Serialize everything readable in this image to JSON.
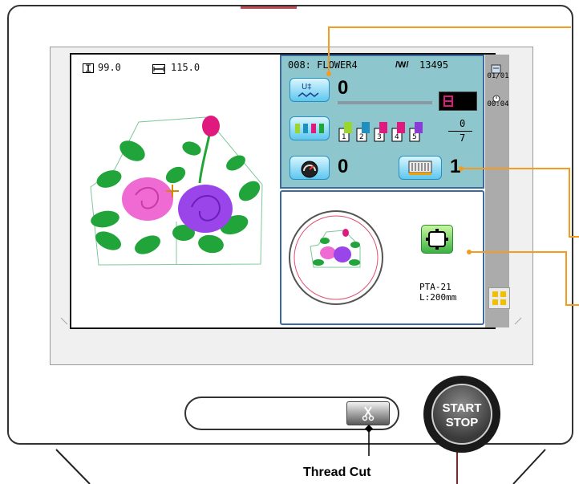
{
  "design": {
    "height_value": "99.0",
    "width_value": "115.0"
  },
  "info": {
    "design_name": "008: FLOWER4",
    "stitch_count": "13495",
    "current_stitch": "0",
    "needle_step_total": "7",
    "needle_step_current": "0",
    "needle_labels": [
      "1",
      "2",
      "3",
      "4",
      "5"
    ],
    "speed_value": "0",
    "needle_number": "1",
    "hoop_name": "PTA-21",
    "hoop_size": "L:200mm"
  },
  "status": {
    "page_counter": "01/01",
    "time": "00:04"
  },
  "controls": {
    "start_stop_line1": "START",
    "start_stop_line2": "STOP",
    "thread_cut_label": "Thread Cut"
  },
  "colors": {
    "panel_bg": "#8dc6cc",
    "panel_border": "#3b6aa3",
    "accent_orange": "#f59b20",
    "needle_colors": [
      "#9bd62f",
      "#1f8fbf",
      "#e0197e",
      "#e0197e",
      "#8a3bd8"
    ]
  }
}
